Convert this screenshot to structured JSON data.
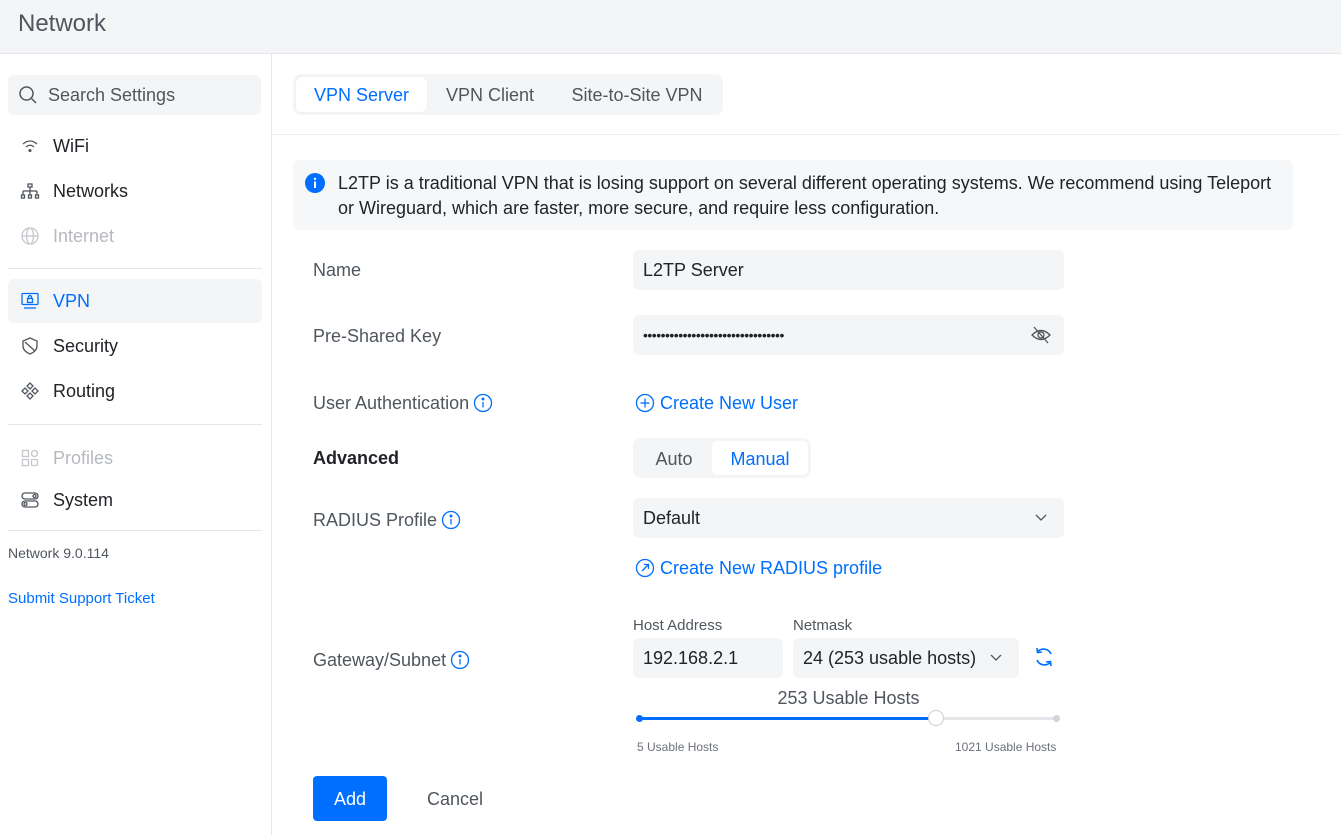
{
  "app": {
    "title": "Network"
  },
  "sidebar": {
    "search_placeholder": "Search Settings",
    "items": [
      {
        "label": "WiFi",
        "icon": "wifi-icon",
        "state": "normal"
      },
      {
        "label": "Networks",
        "icon": "network-tree-icon",
        "state": "normal"
      },
      {
        "label": "Internet",
        "icon": "globe-icon",
        "state": "disabled"
      },
      {
        "label": "VPN",
        "icon": "vpn-icon",
        "state": "active"
      },
      {
        "label": "Security",
        "icon": "shield-icon",
        "state": "normal"
      },
      {
        "label": "Routing",
        "icon": "routing-icon",
        "state": "normal"
      },
      {
        "label": "Profiles",
        "icon": "profiles-icon",
        "state": "disabled"
      },
      {
        "label": "System",
        "icon": "system-icon",
        "state": "normal"
      }
    ],
    "version": "Network 9.0.114",
    "support_link": "Submit Support Ticket"
  },
  "tabs": [
    {
      "label": "VPN Server",
      "active": true
    },
    {
      "label": "VPN Client",
      "active": false
    },
    {
      "label": "Site-to-Site VPN",
      "active": false
    }
  ],
  "notice": {
    "text": "L2TP is a traditional VPN that is losing support on several different operating systems. We recommend using Teleport or Wireguard, which are faster, more secure, and require less configuration."
  },
  "form": {
    "name_label": "Name",
    "name_value": "L2TP Server",
    "psk_label": "Pre-Shared Key",
    "psk_value": "••••••••••••••••••••••••••••••••",
    "user_auth_label": "User Authentication",
    "create_user_link": "Create New User",
    "advanced_label": "Advanced",
    "advanced_options": [
      "Auto",
      "Manual"
    ],
    "advanced_selected": "Manual",
    "radius_label": "RADIUS Profile",
    "radius_value": "Default",
    "create_radius_link": "Create New RADIUS profile",
    "gateway_label": "Gateway/Subnet",
    "host_address_label": "Host Address",
    "host_address_value": "192.168.2.1",
    "netmask_label": "Netmask",
    "netmask_value": "24 (253 usable hosts)",
    "usable_hosts_title": "253 Usable Hosts",
    "slider_min_label": "5 Usable Hosts",
    "slider_max_label": "1021 Usable Hosts",
    "slider_fraction": 0.71
  },
  "actions": {
    "add_label": "Add",
    "cancel_label": "Cancel"
  },
  "colors": {
    "accent": "#006fff",
    "text": "#212327",
    "muted": "#50565e",
    "disabled": "#b6b9bf"
  }
}
